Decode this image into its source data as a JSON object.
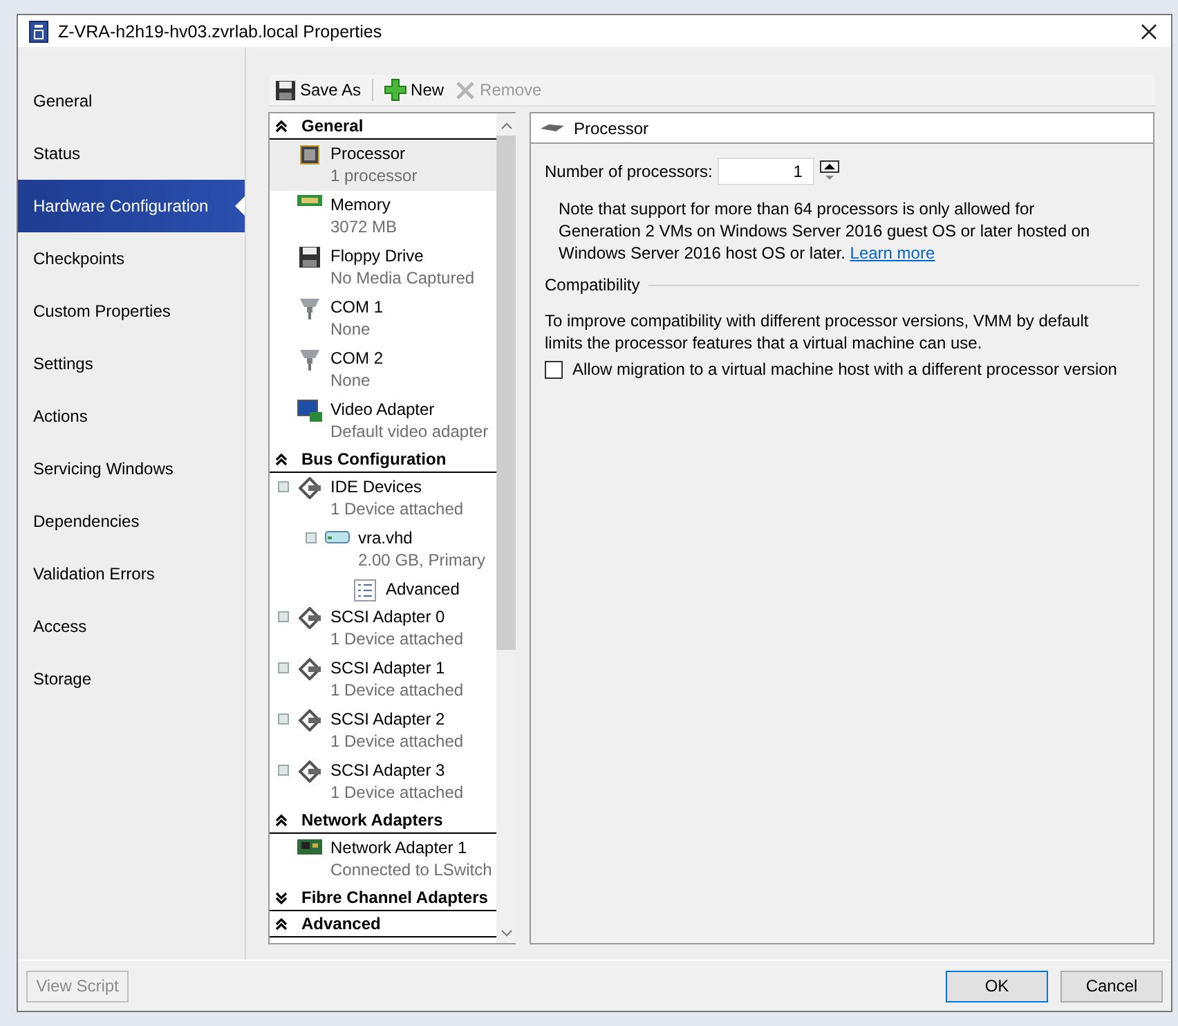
{
  "window": {
    "title": "Z-VRA-h2h19-hv03.zvrlab.local Properties"
  },
  "nav": [
    {
      "label": "General",
      "selected": false
    },
    {
      "label": "Status",
      "selected": false
    },
    {
      "label": "Hardware Configuration",
      "selected": true
    },
    {
      "label": "Checkpoints",
      "selected": false
    },
    {
      "label": "Custom Properties",
      "selected": false
    },
    {
      "label": "Settings",
      "selected": false
    },
    {
      "label": "Actions",
      "selected": false
    },
    {
      "label": "Servicing Windows",
      "selected": false
    },
    {
      "label": "Dependencies",
      "selected": false
    },
    {
      "label": "Validation Errors",
      "selected": false
    },
    {
      "label": "Access",
      "selected": false
    },
    {
      "label": "Storage",
      "selected": false
    }
  ],
  "toolbar": [
    {
      "kind": "save",
      "label": "Save As",
      "disabled": false
    },
    {
      "kind": "new",
      "label": "New",
      "disabled": false
    },
    {
      "kind": "remove",
      "label": "Remove",
      "disabled": true
    }
  ],
  "tree": [
    {
      "title": "General",
      "expanded": true,
      "items": [
        {
          "kind": "processor",
          "name": "Processor",
          "detail": "1 processor",
          "selected": true
        },
        {
          "kind": "memory",
          "name": "Memory",
          "detail": "3072 MB",
          "selected": false
        },
        {
          "kind": "floppy",
          "name": "Floppy Drive",
          "detail": "No Media Captured",
          "selected": false
        },
        {
          "kind": "com",
          "name": "COM 1",
          "detail": "None",
          "selected": false
        },
        {
          "kind": "com",
          "name": "COM 2",
          "detail": "None",
          "selected": false
        },
        {
          "kind": "video",
          "name": "Video Adapter",
          "detail": "Default video adapter",
          "selected": false
        }
      ]
    },
    {
      "title": "Bus Configuration",
      "expanded": true,
      "items": [
        {
          "kind": "adapter",
          "name": "IDE Devices",
          "detail": "1 Device attached",
          "selected": false,
          "children": [
            {
              "kind": "disk",
              "name": "vra.vhd",
              "detail": "2.00 GB, Primary",
              "selected": false,
              "children": [
                {
                  "kind": "advanced",
                  "name": "Advanced",
                  "selected": false
                }
              ]
            }
          ]
        },
        {
          "kind": "adapter",
          "name": "SCSI Adapter 0",
          "detail": "1 Device attached",
          "selected": false
        },
        {
          "kind": "adapter",
          "name": "SCSI Adapter 1",
          "detail": "1 Device attached",
          "selected": false
        },
        {
          "kind": "adapter",
          "name": "SCSI Adapter 2",
          "detail": "1 Device attached",
          "selected": false
        },
        {
          "kind": "adapter",
          "name": "SCSI Adapter 3",
          "detail": "1 Device attached",
          "selected": false
        }
      ]
    },
    {
      "title": "Network Adapters",
      "expanded": true,
      "items": [
        {
          "kind": "network",
          "name": "Network Adapter 1",
          "detail": "Connected to LSwitch",
          "selected": false
        }
      ]
    },
    {
      "title": "Fibre Channel Adapters",
      "expanded": false
    },
    {
      "title": "Advanced",
      "expanded": true
    }
  ],
  "detail": {
    "title": "Processor",
    "count_label": "Number of processors:",
    "count_value": "1",
    "note": "Note that support for more than 64 processors is only allowed for Generation 2 VMs on Windows Server 2016 guest OS or later hosted on Windows Server 2016 host OS or later.",
    "link": "Learn more",
    "group": "Compatibility",
    "text": "To improve compatibility with different processor versions, VMM by default limits the processor features that a virtual machine can use.",
    "checkbox": {
      "label": "Allow migration to a virtual machine host with a different processor version",
      "checked": false
    }
  },
  "footer": {
    "view_script": {
      "label": "View Script",
      "disabled": true
    },
    "ok": "OK",
    "cancel": "Cancel"
  }
}
